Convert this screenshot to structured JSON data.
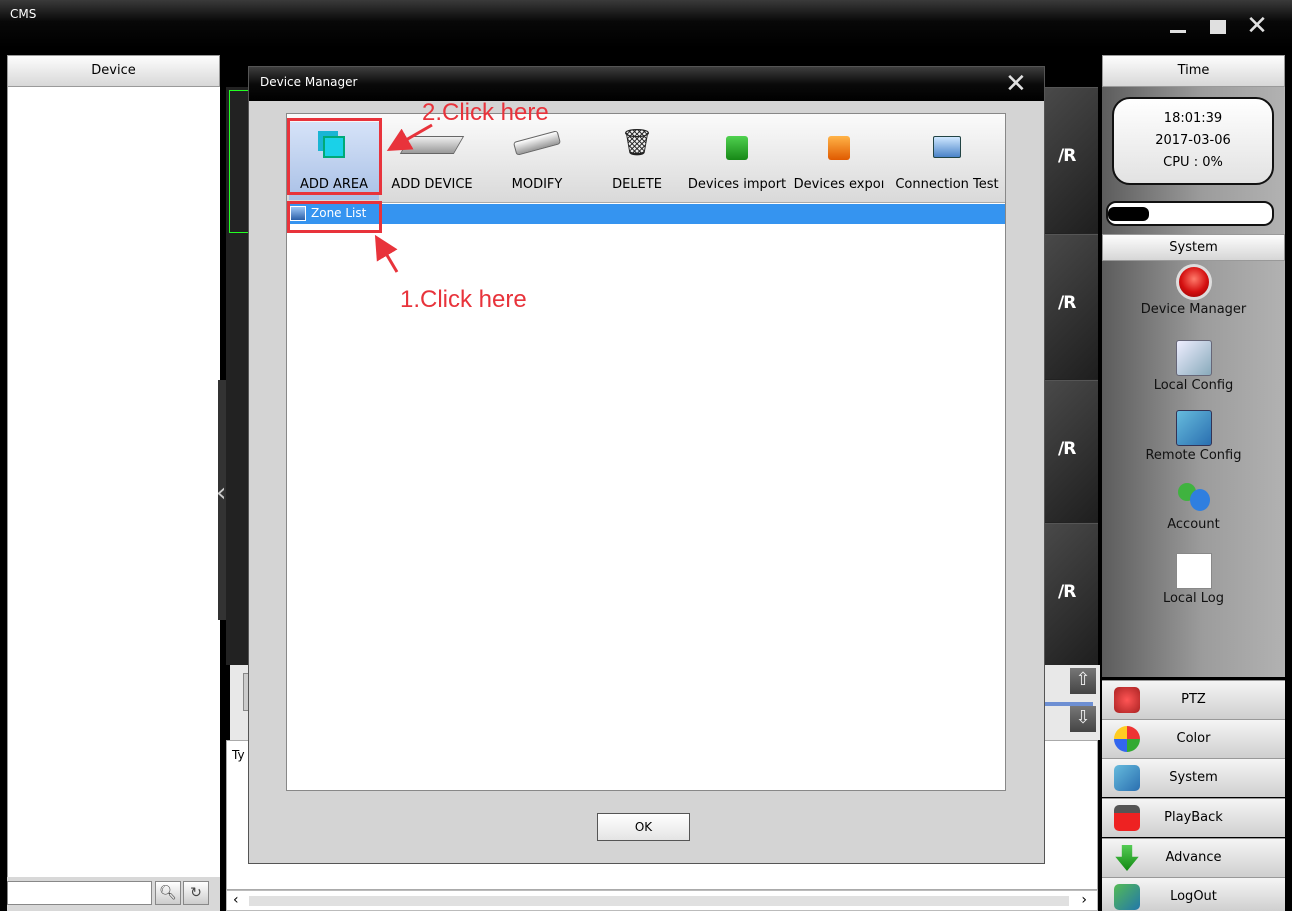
{
  "window": {
    "title": "CMS"
  },
  "headers": {
    "device": "Device",
    "time": "Time"
  },
  "status": {
    "time": "18:01:39",
    "date": "2017-03-06",
    "cpu": "CPU : 0%",
    "progress": 0.25
  },
  "system_section": {
    "title": "System",
    "items": [
      {
        "label": "Device Manager",
        "icon": "device-manager-icon"
      },
      {
        "label": "Local Config",
        "icon": "local-config-icon"
      },
      {
        "label": "Remote Config",
        "icon": "remote-config-icon"
      },
      {
        "label": "Account",
        "icon": "account-icon"
      },
      {
        "label": "Local Log",
        "icon": "local-log-icon"
      }
    ]
  },
  "menu": [
    {
      "label": "PTZ",
      "icon": "ptz-icon"
    },
    {
      "label": "Color",
      "icon": "color-icon"
    },
    {
      "label": "System",
      "icon": "system-icon"
    },
    {
      "label": "PlayBack",
      "icon": "playback-icon"
    },
    {
      "label": "Advance",
      "icon": "advance-icon"
    },
    {
      "label": "LogOut",
      "icon": "logout-icon"
    }
  ],
  "video": {
    "logo": "/R"
  },
  "log": {
    "column": "Ty"
  },
  "dialog": {
    "title": "Device Manager",
    "toolbar": [
      {
        "label": "ADD AREA",
        "icon": "add-area-icon"
      },
      {
        "label": "ADD DEVICE",
        "icon": "add-device-icon"
      },
      {
        "label": "MODIFY",
        "icon": "modify-icon"
      },
      {
        "label": "DELETE",
        "icon": "delete-icon"
      },
      {
        "label": "Devices import",
        "icon": "devices-import-icon"
      },
      {
        "label": "Devices expoı",
        "icon": "devices-export-icon"
      },
      {
        "label": "Connection Test",
        "icon": "connection-test-icon"
      }
    ],
    "tree": {
      "root": "Zone List"
    },
    "ok_label": "OK"
  },
  "annotations": {
    "step1": "1.Click here",
    "step2": "2.Click here",
    "color": "#e8333b"
  }
}
